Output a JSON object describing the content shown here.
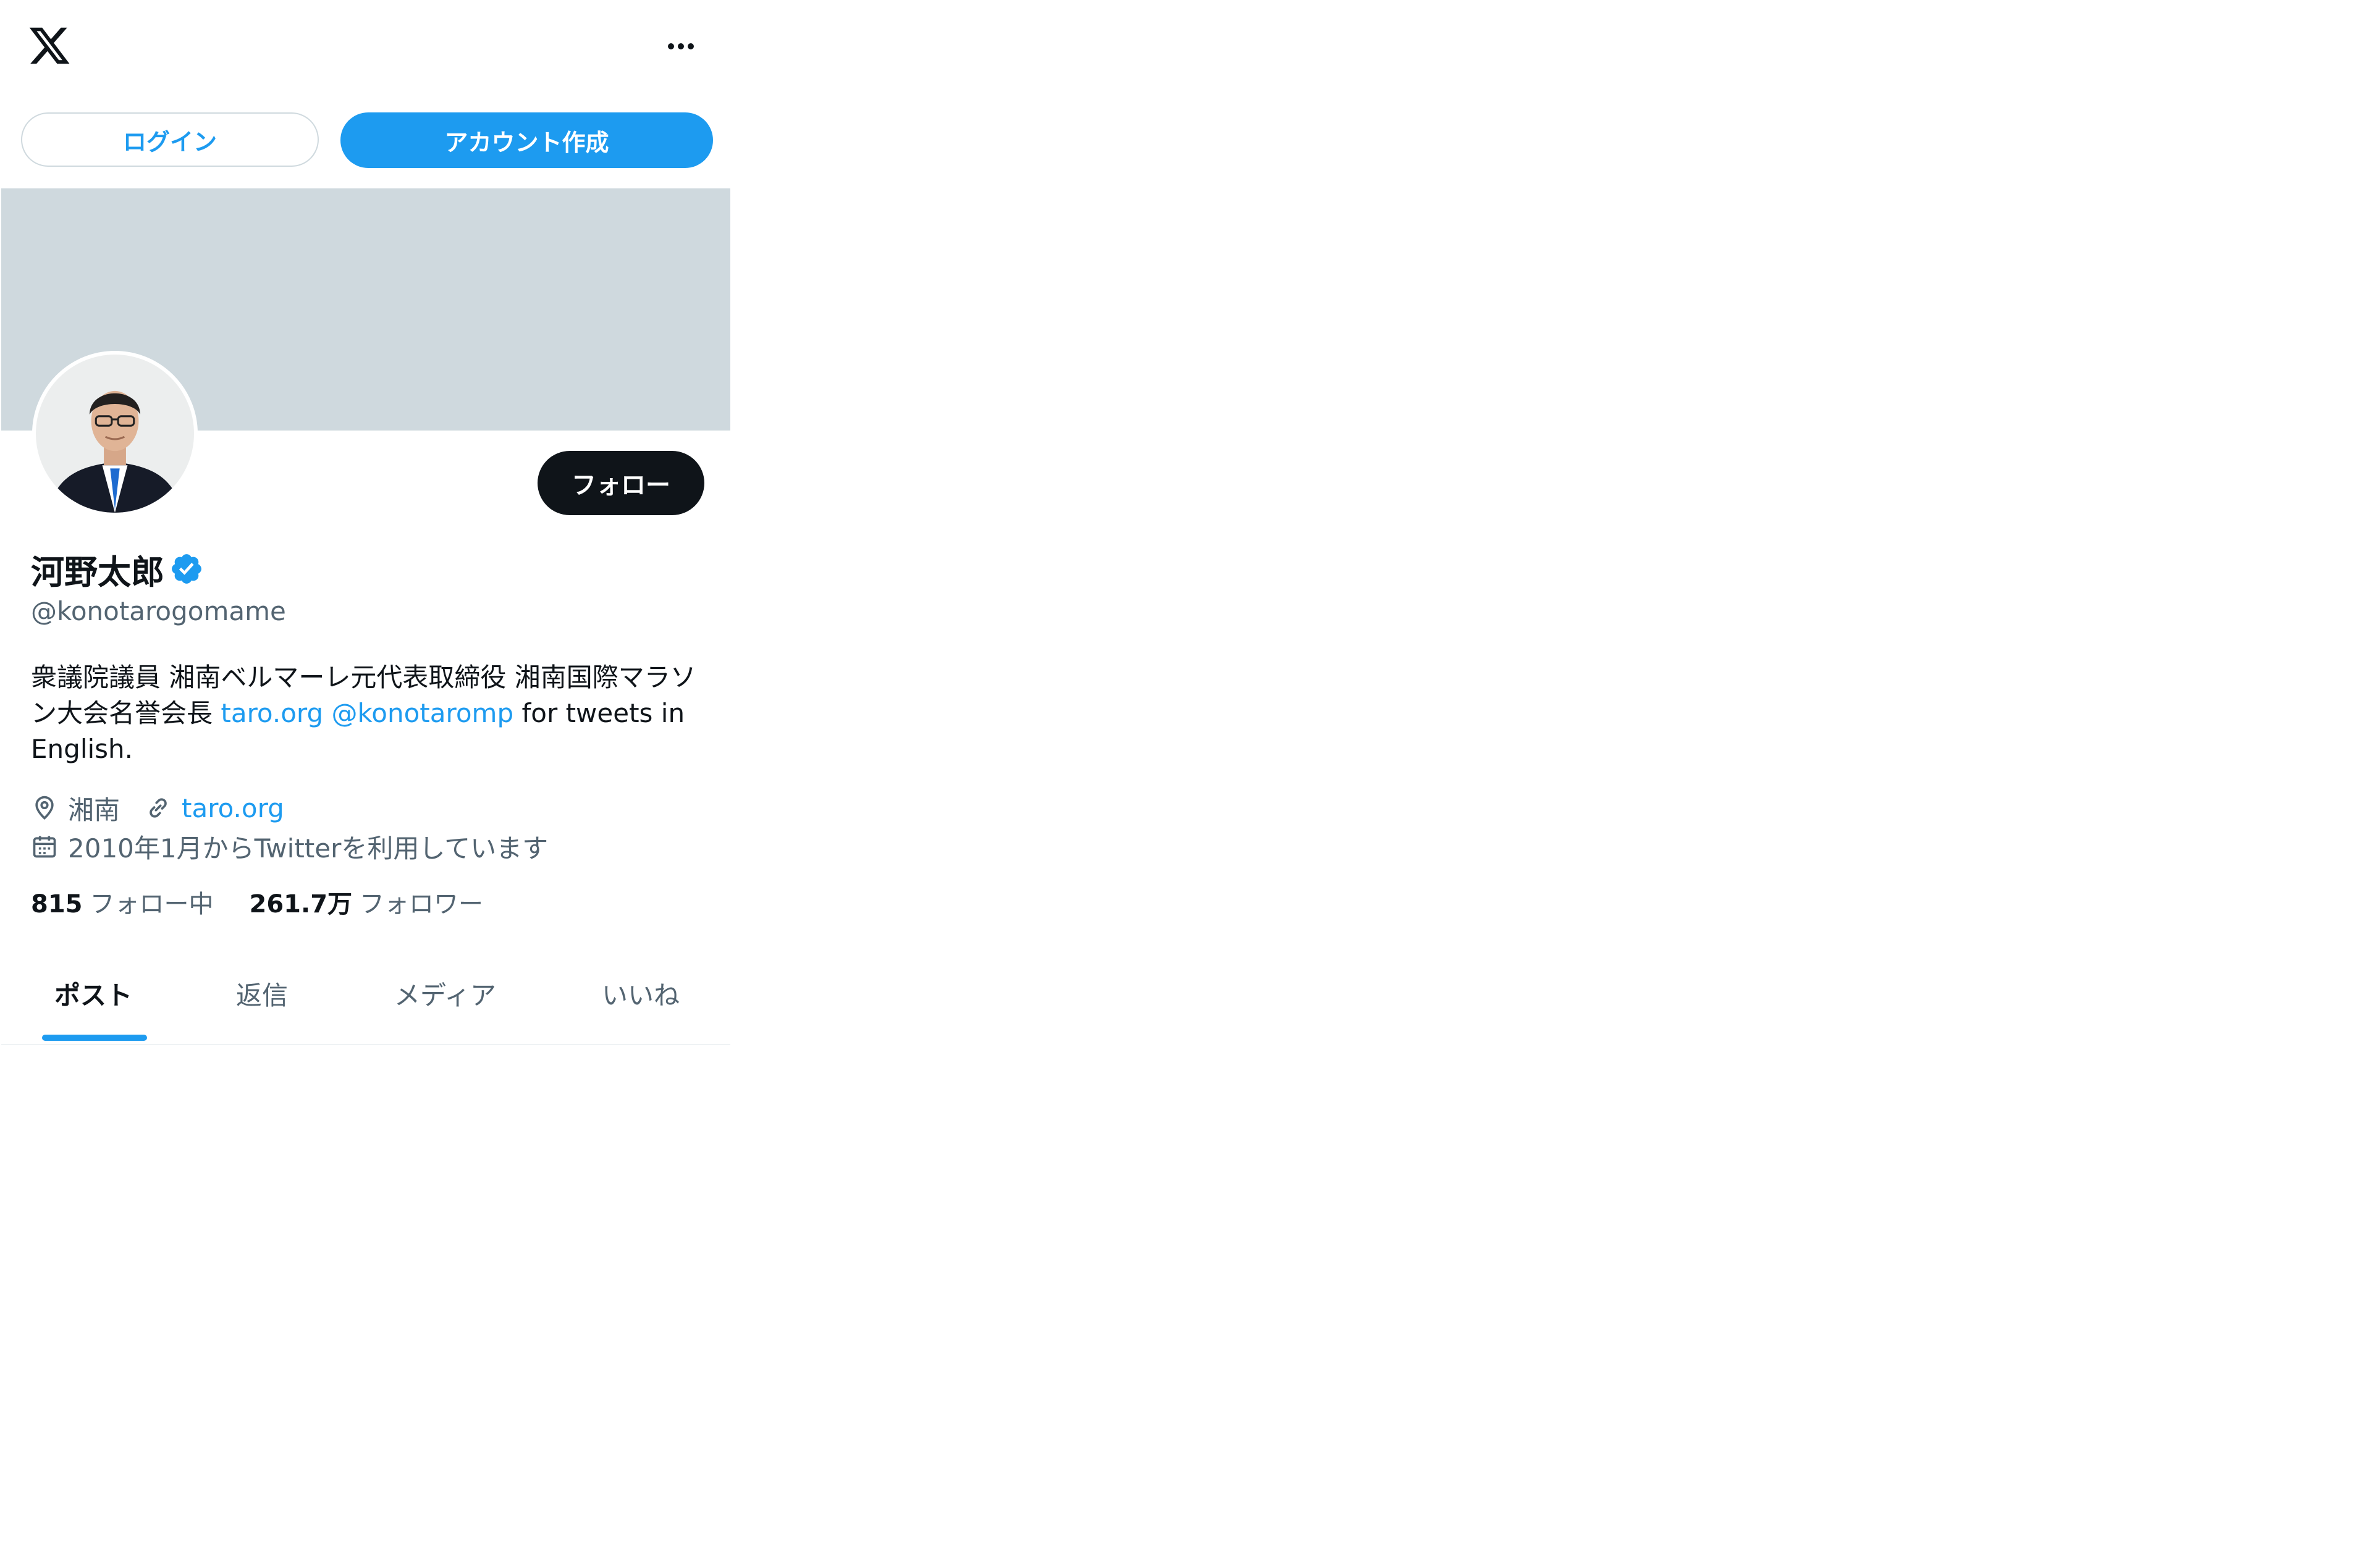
{
  "header": {
    "logo_icon": "x-logo-icon",
    "more_icon": "more-horizontal-icon"
  },
  "auth": {
    "login_label": "ログイン",
    "signup_label": "アカウント作成"
  },
  "profile": {
    "follow_label": "フォロー",
    "name": "河野太郎",
    "verified_icon": "verified-badge-icon",
    "handle": "@konotarogomame",
    "bio": {
      "line1": "衆議院議員 湘南ベルマーレ元代表取締役 湘南国際マラソ",
      "line2_pre": "ン大会名誉会長 ",
      "link1": "taro.org",
      "sep": " ",
      "link2": "@konotaromp",
      "line2_post": " for tweets in",
      "line3": "English."
    },
    "location": "湘南",
    "location_icon": "location-pin-icon",
    "website": "taro.org",
    "website_icon": "link-icon",
    "joined": "2010年1月からTwitterを利用しています",
    "joined_icon": "calendar-icon",
    "following_count": "815",
    "following_label": "フォロー中",
    "followers_count": "261.7万",
    "followers_label": "フォロワー"
  },
  "tabs": [
    {
      "label": "ポスト",
      "active": true
    },
    {
      "label": "返信",
      "active": false
    },
    {
      "label": "メディア",
      "active": false
    },
    {
      "label": "いいね",
      "active": false
    }
  ],
  "colors": {
    "accent": "#1d9bf0",
    "text": "#0f1419",
    "secondary": "#536471",
    "banner": "#cfd9de"
  }
}
